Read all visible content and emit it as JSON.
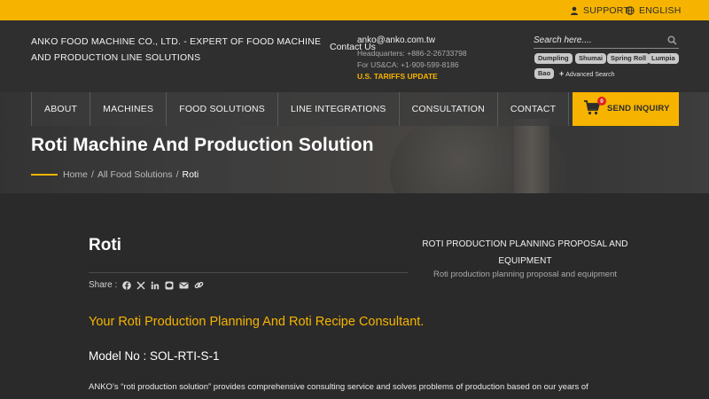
{
  "topbar": {
    "support": "SUPPORT",
    "language": "ENGLISH"
  },
  "header": {
    "company": "ANKO FOOD MACHINE CO., LTD. - EXPERT OF FOOD MACHINE AND PRODUCTION LINE SOLUTIONS",
    "contact_us": "Contact Us",
    "email": "anko@anko.com.tw",
    "headquarters": "Headquarters: +886-2-26733798",
    "us_ca": "For US&CA: +1-909-599-8186",
    "tariffs": "U.S. TARIFFS UPDATE"
  },
  "search": {
    "placeholder": "Search here....",
    "tags": [
      "Dumpling",
      "Shumai",
      "Spring Roll",
      "Lumpia",
      "Bao"
    ],
    "advanced": "Advanced Search"
  },
  "nav": {
    "items": [
      "ABOUT",
      "MACHINES",
      "FOOD SOLUTIONS",
      "LINE INTEGRATIONS",
      "CONSULTATION",
      "CONTACT"
    ],
    "send_inquiry": "SEND INQUIRY",
    "cart_count": "0"
  },
  "hero": {
    "title": "Roti Machine And Production Solution",
    "breadcrumb": [
      "Home",
      "All Food Solutions",
      "Roti"
    ]
  },
  "main": {
    "title": "Roti",
    "share_label": "Share :",
    "share_icons": [
      "facebook-icon",
      "x-icon",
      "linkedin-icon",
      "line-icon",
      "email-icon",
      "link-icon"
    ],
    "side_title": "ROTI PRODUCTION PLANNING PROPOSAL AND EQUIPMENT",
    "side_subtitle": "Roti production planning proposal and equipment",
    "slogan": "Your Roti Production Planning And Roti Recipe Consultant.",
    "model": "Model No : SOL-RTI-S-1",
    "description": "ANKO’s “roti production solution” provides comprehensive consulting service and solves problems of production based on our years of"
  },
  "colors": {
    "accent": "#f6b400",
    "header_bg": "#2f2f2f",
    "body_bg": "#2a2a2a"
  }
}
